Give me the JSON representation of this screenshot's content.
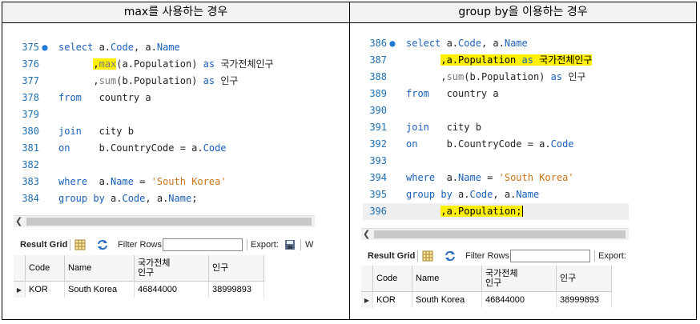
{
  "left": {
    "header": "max를 사용하는 경우",
    "lines": [
      {
        "num": "375",
        "dot": true,
        "parts": [
          [
            "kw",
            "select "
          ],
          [
            "tx",
            "a."
          ],
          [
            "kw",
            "Code"
          ],
          [
            "tx",
            ", a."
          ],
          [
            "kw",
            "Name"
          ]
        ]
      },
      {
        "num": "376",
        "parts": [
          [
            "tx",
            "      "
          ],
          [
            "hl",
            ","
          ],
          [
            "hl fn",
            "max"
          ],
          [
            "tx",
            "(a.Population) "
          ],
          [
            "kw",
            "as"
          ],
          [
            "tx",
            " 국가전체인구"
          ]
        ]
      },
      {
        "num": "377",
        "parts": [
          [
            "tx",
            "      ,"
          ],
          [
            "fn",
            "sum"
          ],
          [
            "tx",
            "(b.Population) "
          ],
          [
            "kw",
            "as"
          ],
          [
            "tx",
            " 인구"
          ]
        ]
      },
      {
        "num": "378",
        "parts": [
          [
            "kw",
            "from"
          ],
          [
            "tx",
            "   country a"
          ]
        ]
      },
      {
        "num": "379",
        "parts": []
      },
      {
        "num": "380",
        "parts": [
          [
            "kw",
            "join"
          ],
          [
            "tx",
            "   city b"
          ]
        ]
      },
      {
        "num": "381",
        "parts": [
          [
            "kw",
            "on"
          ],
          [
            "tx",
            "     b.CountryCode = a."
          ],
          [
            "kw",
            "Code"
          ]
        ]
      },
      {
        "num": "382",
        "parts": []
      },
      {
        "num": "383",
        "parts": [
          [
            "kw",
            "where"
          ],
          [
            "tx",
            "  a."
          ],
          [
            "kw",
            "Name"
          ],
          [
            "tx",
            " = "
          ],
          [
            "str",
            "'South Korea'"
          ]
        ]
      },
      {
        "num": "384",
        "parts": [
          [
            "kw",
            "group by"
          ],
          [
            "tx",
            " a."
          ],
          [
            "kw",
            "Code"
          ],
          [
            "tx",
            ", a."
          ],
          [
            "kw",
            "Name"
          ],
          [
            "tx",
            ";"
          ]
        ]
      }
    ],
    "toolbar": {
      "result_grid": "Result Grid",
      "filter_rows": "Filter Rows:",
      "export": "Export:",
      "extra": "W"
    },
    "grid": {
      "columns": [
        "Code",
        "Name",
        "국가전체\n인구",
        "인구"
      ],
      "rows": [
        [
          "KOR",
          "South Korea",
          "46844000",
          "38999893"
        ]
      ]
    }
  },
  "right": {
    "header": "group by을 이용하는 경우",
    "lines": [
      {
        "num": "386",
        "dot": true,
        "parts": [
          [
            "kw",
            "select "
          ],
          [
            "tx",
            "a."
          ],
          [
            "kw",
            "Code"
          ],
          [
            "tx",
            ", a."
          ],
          [
            "kw",
            "Name"
          ]
        ]
      },
      {
        "num": "387",
        "parts": [
          [
            "tx",
            "      "
          ],
          [
            "hl",
            ",a.Population "
          ],
          [
            "hl kw",
            "as"
          ],
          [
            "hl",
            " 국가전체인구"
          ]
        ]
      },
      {
        "num": "388",
        "parts": [
          [
            "tx",
            "      ,"
          ],
          [
            "fn",
            "sum"
          ],
          [
            "tx",
            "(b.Population) "
          ],
          [
            "kw",
            "as"
          ],
          [
            "tx",
            " 인구"
          ]
        ]
      },
      {
        "num": "389",
        "parts": [
          [
            "kw",
            "from"
          ],
          [
            "tx",
            "   country a"
          ]
        ]
      },
      {
        "num": "390",
        "parts": []
      },
      {
        "num": "391",
        "parts": [
          [
            "kw",
            "join"
          ],
          [
            "tx",
            "   city b"
          ]
        ]
      },
      {
        "num": "392",
        "parts": [
          [
            "kw",
            "on"
          ],
          [
            "tx",
            "     b.CountryCode = a."
          ],
          [
            "kw",
            "Code"
          ]
        ]
      },
      {
        "num": "393",
        "parts": []
      },
      {
        "num": "394",
        "parts": [
          [
            "kw",
            "where"
          ],
          [
            "tx",
            "  a."
          ],
          [
            "kw",
            "Name"
          ],
          [
            "tx",
            " = "
          ],
          [
            "str",
            "'South Korea'"
          ]
        ]
      },
      {
        "num": "395",
        "parts": [
          [
            "kw",
            "group by"
          ],
          [
            "tx",
            " a."
          ],
          [
            "kw",
            "Code"
          ],
          [
            "tx",
            ", a."
          ],
          [
            "kw",
            "Name"
          ]
        ]
      },
      {
        "num": "396",
        "current": true,
        "parts": [
          [
            "tx",
            "      "
          ],
          [
            "hl",
            ",a.Population;"
          ]
        ]
      }
    ],
    "toolbar": {
      "result_grid": "Result Grid",
      "filter_rows": "Filter Rows:",
      "export": "Export:"
    },
    "grid": {
      "columns": [
        "Code",
        "Name",
        "국가전체\n인구",
        "인구"
      ],
      "rows": [
        [
          "KOR",
          "South Korea",
          "46844000",
          "38999893"
        ]
      ]
    }
  },
  "colors": {
    "keyword": "#1a60b8",
    "function": "#7a7a7a",
    "string": "#c8741a",
    "highlight": "#fff100"
  }
}
